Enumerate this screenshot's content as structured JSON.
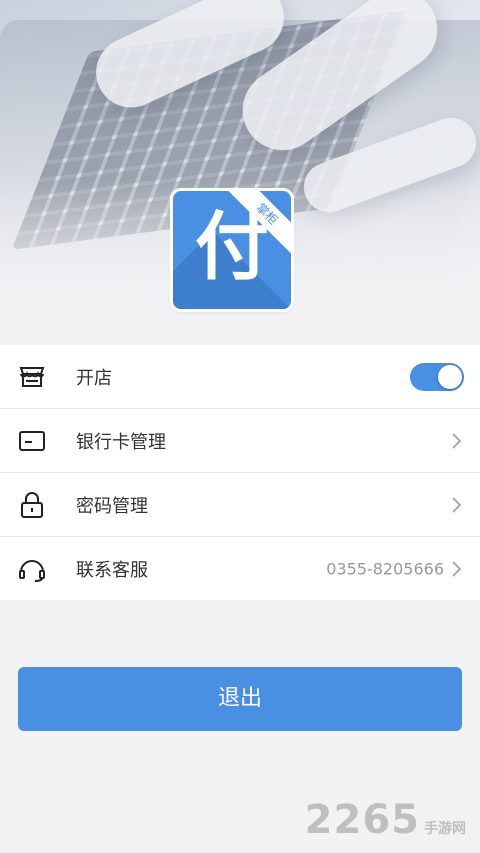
{
  "logo": {
    "glyph": "付",
    "ribbon": "掌柜",
    "color": "#4a90e2"
  },
  "menu": {
    "items": [
      {
        "icon": "store-icon",
        "label": "开店",
        "control": "toggle",
        "toggle_on": true
      },
      {
        "icon": "bank-card-icon",
        "label": "银行卡管理",
        "control": "chevron"
      },
      {
        "icon": "lock-icon",
        "label": "密码管理",
        "control": "chevron"
      },
      {
        "icon": "headset-icon",
        "label": "联系客服",
        "value": "0355-8205666",
        "control": "chevron"
      }
    ]
  },
  "logout": {
    "label": "退出"
  },
  "watermark": {
    "big": "2265",
    "small": "手游网"
  },
  "colors": {
    "accent": "#4a90e2",
    "background": "#f2f2f4",
    "text": "#333333",
    "muted": "#999999"
  }
}
